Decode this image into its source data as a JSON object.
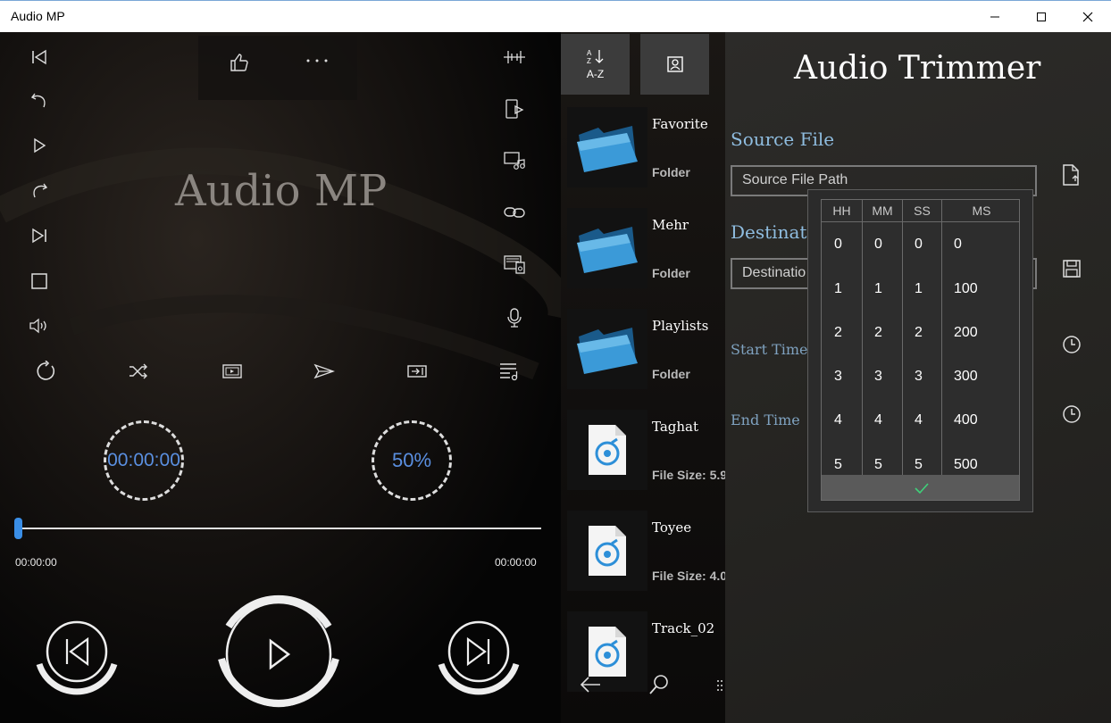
{
  "window": {
    "title": "Audio MP"
  },
  "player": {
    "title": "Audio MP",
    "elapsed_circle": "00:00:00",
    "volume_circle": "50%",
    "time_start": "00:00:00",
    "time_end": "00:00:00",
    "progress": 0.0
  },
  "library": {
    "sort_label": "A-Z",
    "items": [
      {
        "name": "Favorite",
        "sub": "Folder",
        "kind": "folder"
      },
      {
        "name": "Mehr",
        "sub": "Folder",
        "kind": "folder"
      },
      {
        "name": "Playlists",
        "sub": "Folder",
        "kind": "folder"
      },
      {
        "name": "Taghat",
        "sub": "File Size: 5.9",
        "kind": "file"
      },
      {
        "name": "Toyee",
        "sub": "File Size: 4.0",
        "kind": "file"
      },
      {
        "name": "Track_02",
        "sub": "",
        "kind": "file"
      }
    ]
  },
  "trimmer": {
    "title": "Audio Trimmer",
    "source_label": "Source File",
    "source_placeholder": "Source File Path",
    "dest_label": "Destinati",
    "dest_placeholder": "Destinatio",
    "start_label": "Start Time",
    "end_label": "End Time"
  },
  "picker": {
    "headers": [
      "HH",
      "MM",
      "SS",
      "MS"
    ],
    "hh": [
      "0",
      "1",
      "2",
      "3",
      "4",
      "5"
    ],
    "mm": [
      "0",
      "1",
      "2",
      "3",
      "4",
      "5"
    ],
    "ss": [
      "0",
      "1",
      "2",
      "3",
      "4",
      "5"
    ],
    "ms": [
      "0",
      "100",
      "200",
      "300",
      "400",
      "500"
    ]
  },
  "colors": {
    "accent": "#3a8ee6",
    "trimmer_label": "#8fbde0",
    "circle_text": "#5a8fe0"
  }
}
